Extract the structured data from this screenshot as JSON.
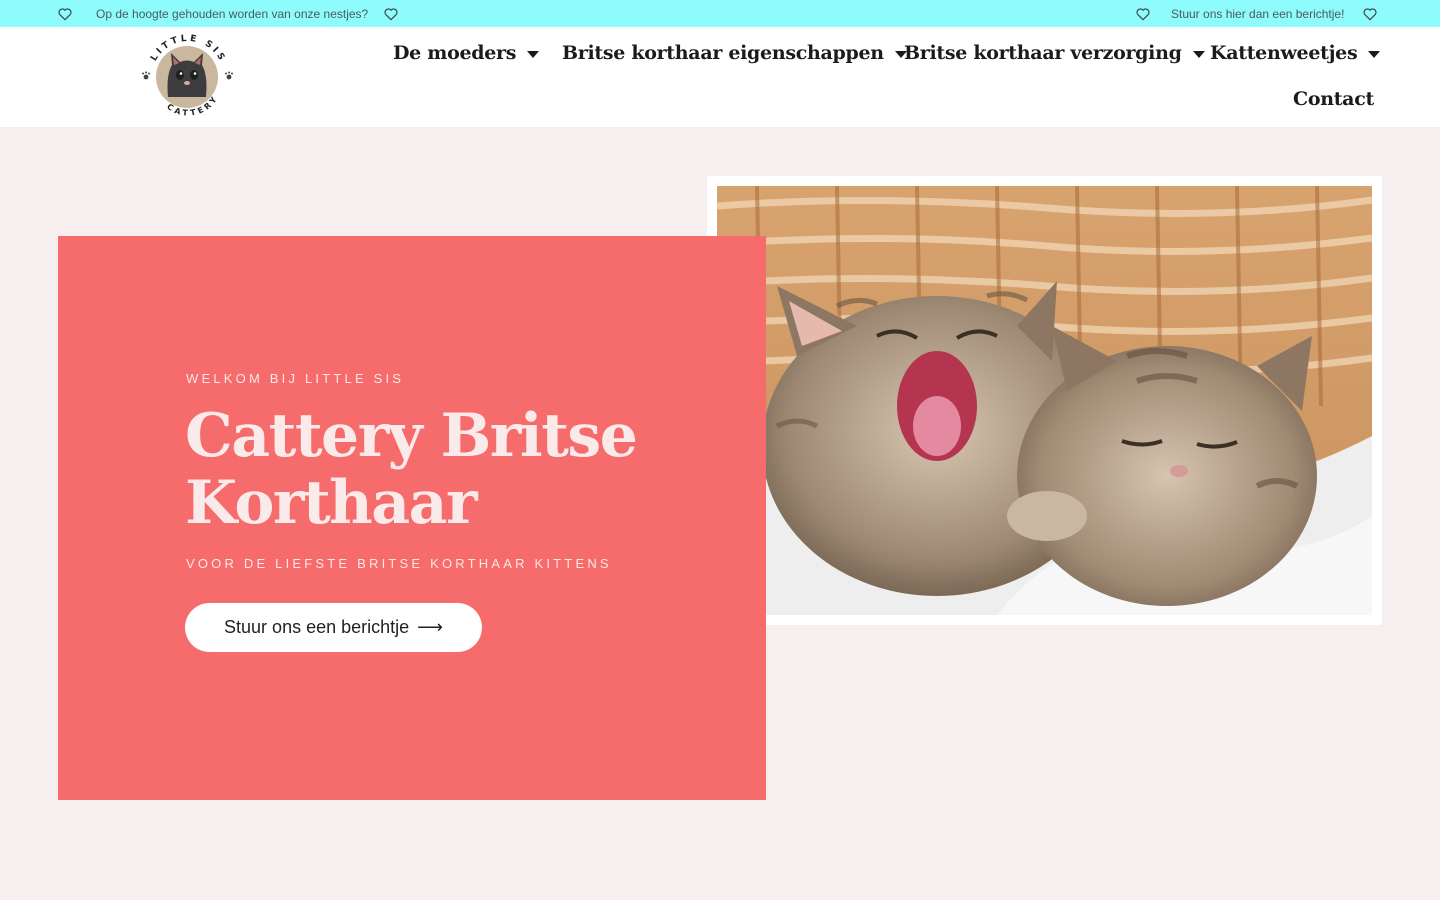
{
  "topbar": {
    "left_text": "Op de hoogte gehouden worden van onze nestjes?",
    "right_text": "Stuur ons hier dan een berichtje!"
  },
  "logo": {
    "top_text": "LITTLE SIS",
    "bottom_text": "CATTERY"
  },
  "nav": {
    "items": [
      {
        "label": "De moeders",
        "has_dropdown": true
      },
      {
        "label": "Britse korthaar eigenschappen",
        "has_dropdown": true
      },
      {
        "label": "Britse korthaar verzorging",
        "has_dropdown": true
      },
      {
        "label": "Kattenweetjes",
        "has_dropdown": true
      },
      {
        "label": "Contact",
        "has_dropdown": false
      }
    ]
  },
  "hero": {
    "eyebrow": "WELKOM BIJ LITTLE SIS",
    "title": "Cattery Britse Korthaar",
    "subline": "VOOR DE LIEFSTE BRITSE KORTHAAR KITTENS",
    "cta_label": "Stuur ons een berichtje",
    "cta_arrow": "⟶"
  },
  "colors": {
    "topbar": "#8efcfd",
    "accent_pink": "#f66b6b",
    "page_bg": "#f6eeef"
  },
  "icons": [
    "heart-icon",
    "caret-down-icon",
    "arrow-right-icon"
  ]
}
